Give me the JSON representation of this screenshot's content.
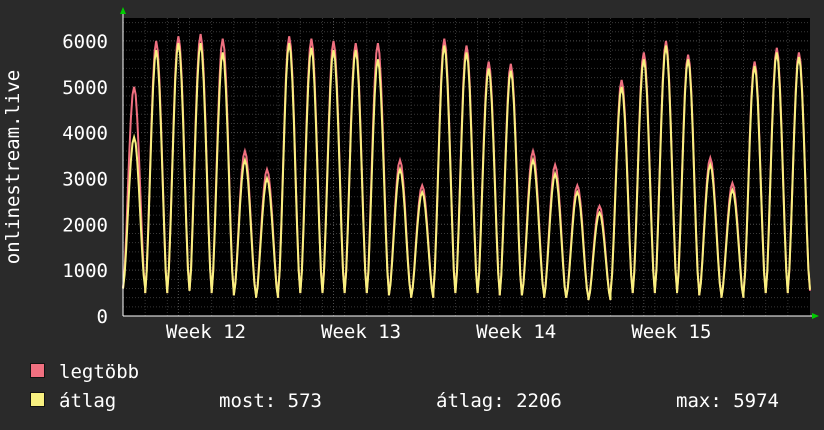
{
  "chart_data": {
    "type": "line",
    "ylabel": "onlinestream.live",
    "ylim": [
      0,
      6500
    ],
    "yticks": [
      0,
      1000,
      2000,
      3000,
      4000,
      5000,
      6000
    ],
    "x_labels": [
      "Week 12",
      "Week 13",
      "Week 14",
      "Week 15"
    ],
    "grid": true,
    "legend_placement": "bottom-left",
    "colors": {
      "max": "#f07080",
      "avg": "#f8f080",
      "background": "#2a2a2a",
      "plot": "#000000",
      "grid": "#505050",
      "axis_arrow": "#00cc00"
    },
    "series": [
      {
        "name": "legtöbb",
        "values": [
          5000,
          6000,
          6100,
          6150,
          6050,
          3600,
          3200,
          6100,
          6050,
          6000,
          5950,
          5950,
          3400,
          2850,
          6050,
          5900,
          5550,
          5500,
          3600,
          3300,
          2850,
          2400,
          5150,
          5750,
          6000,
          5700,
          3450,
          2900,
          5550,
          5850,
          5750
        ],
        "minima": [
          600,
          500,
          550,
          550,
          500,
          450,
          400,
          500,
          500,
          500,
          500,
          500,
          450,
          400,
          500,
          500,
          500,
          450,
          450,
          400,
          400,
          350,
          500,
          500,
          550,
          500,
          450,
          400,
          500,
          500,
          550
        ]
      },
      {
        "name": "átlag",
        "values": [
          3900,
          5800,
          5950,
          5950,
          5750,
          3400,
          3000,
          5950,
          5850,
          5800,
          5800,
          5600,
          3200,
          2700,
          5900,
          5750,
          5400,
          5350,
          3400,
          3100,
          2700,
          2250,
          5000,
          5600,
          5900,
          5600,
          3300,
          2750,
          5450,
          5750,
          5650
        ],
        "minima": [
          600,
          500,
          550,
          550,
          500,
          450,
          400,
          500,
          500,
          500,
          500,
          500,
          450,
          400,
          500,
          500,
          500,
          450,
          450,
          400,
          400,
          350,
          500,
          500,
          550,
          500,
          450,
          400,
          500,
          500,
          573
        ]
      }
    ]
  },
  "stats": {
    "current_label": "most:",
    "current_value": "573",
    "average_label": "átlag:",
    "average_value": "2206",
    "max_label": "max:",
    "max_value": "5974"
  }
}
